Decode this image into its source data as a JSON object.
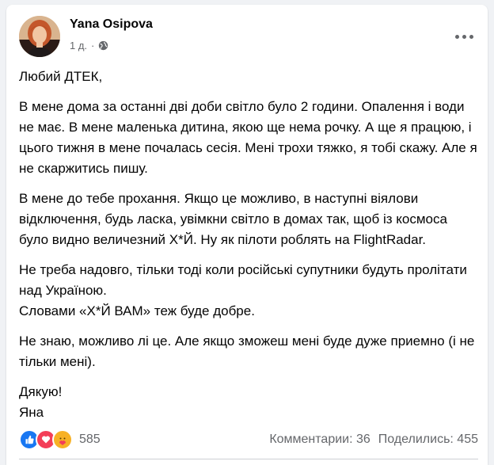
{
  "post": {
    "author": "Yana Osipova",
    "time": "1 д.",
    "separator": "·",
    "paragraphs": [
      [
        "Любий ДТЕК,"
      ],
      [
        "В мене дома за останні дві доби світло було 2 години. Опалення і води не має. В мене маленька дитина, якою ще нема рочку. А ще я працюю, і цього тижня в мене почалась сесія. Мені трохи тяжко, я тобі скажу. Але я не скаржитись пишу."
      ],
      [
        "В мене до тебе прохання. Якщо це можливо, в наступні віялови відключення, будь ласка, увімкни світло в домах так, щоб із космоса було видно величезний Х*Й. Ну як пілоти роблять на FlightRadar."
      ],
      [
        "Не треба надовго, тільки тоді коли російські супутники будуть пролітати над Україною.",
        "Словами «Х*Й ВАМ» теж буде добре."
      ],
      [
        "Не знаю, можливо лі це. Але якщо зможеш мені буде дуже приемно (і не тільки мені)."
      ],
      [
        "Дякую!",
        "Яна"
      ]
    ]
  },
  "footer": {
    "reaction_count": "585",
    "comments": "Комментарии: 36",
    "shares": "Поделились: 455"
  },
  "icons": {
    "avatar": "avatar-photo",
    "privacy": "globe-icon",
    "more": "more-options-icon",
    "reactions": [
      "like-icon",
      "love-icon",
      "care-icon"
    ]
  },
  "colors": {
    "like": "#1877f2",
    "love": "#f33e58",
    "care": "#f7b125",
    "secondary_text": "#65676b"
  }
}
